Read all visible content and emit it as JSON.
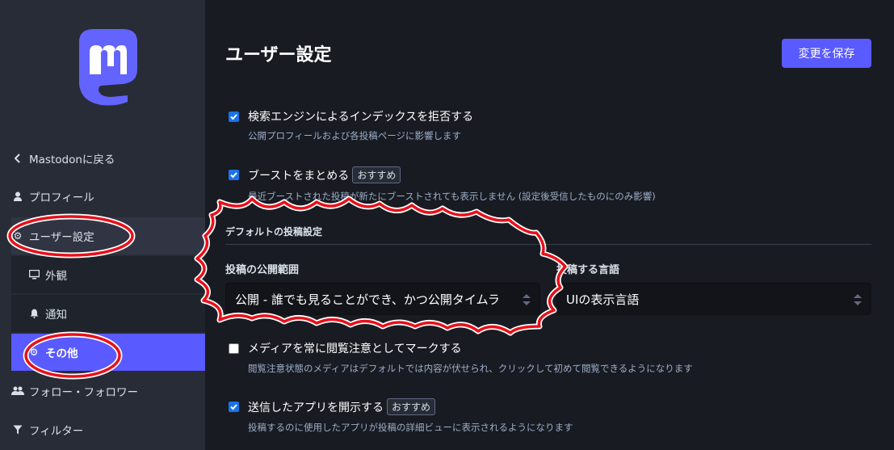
{
  "sidebar": {
    "items": [
      {
        "icon": "chevron-left-icon",
        "label": "Mastodonに戻る"
      },
      {
        "icon": "user-icon",
        "label": "プロフィール"
      },
      {
        "icon": "gear-icon",
        "label": "ユーザー設定"
      },
      {
        "icon": "monitor-icon",
        "label": "外観"
      },
      {
        "icon": "bell-icon",
        "label": "通知"
      },
      {
        "icon": "gear-icon",
        "label": "その他"
      },
      {
        "icon": "users-icon",
        "label": "フォロー・フォロワー"
      },
      {
        "icon": "filter-icon",
        "label": "フィルター"
      }
    ]
  },
  "main": {
    "title": "ユーザー設定",
    "save_label": "変更を保存",
    "options": [
      {
        "label": "検索エンジンによるインデックスを拒否する",
        "hint": "公開プロフィールおよび各投稿ページに影響します",
        "checked": true,
        "badge": ""
      },
      {
        "label": "ブーストをまとめる",
        "hint": "最近ブーストされた投稿が新たにブーストされても表示しません (設定後受信したものにのみ影響)",
        "checked": true,
        "badge": "おすすめ"
      },
      {
        "label": "メディアを常に閲覧注意としてマークする",
        "hint": "閲覧注意状態のメディアはデフォルトでは内容が伏せられ、クリックして初めて閲覧できるようになります",
        "checked": false,
        "badge": ""
      },
      {
        "label": "送信したアプリを開示する",
        "hint": "投稿するのに使用したアプリが投稿の詳細ビューに表示されるようになります",
        "checked": true,
        "badge": "おすすめ"
      }
    ],
    "section_title": "デフォルトの投稿設定",
    "visibility": {
      "label": "投稿の公開範囲",
      "value": "公開 - 誰でも見ることができ、かつ公開タイムラ"
    },
    "language": {
      "label": "投稿する言語",
      "value": "UIの表示言語"
    }
  },
  "colors": {
    "accent": "#595aff",
    "annotation": "#e8101a",
    "sidebar_bg": "#282c37",
    "main_bg": "#191b22"
  }
}
